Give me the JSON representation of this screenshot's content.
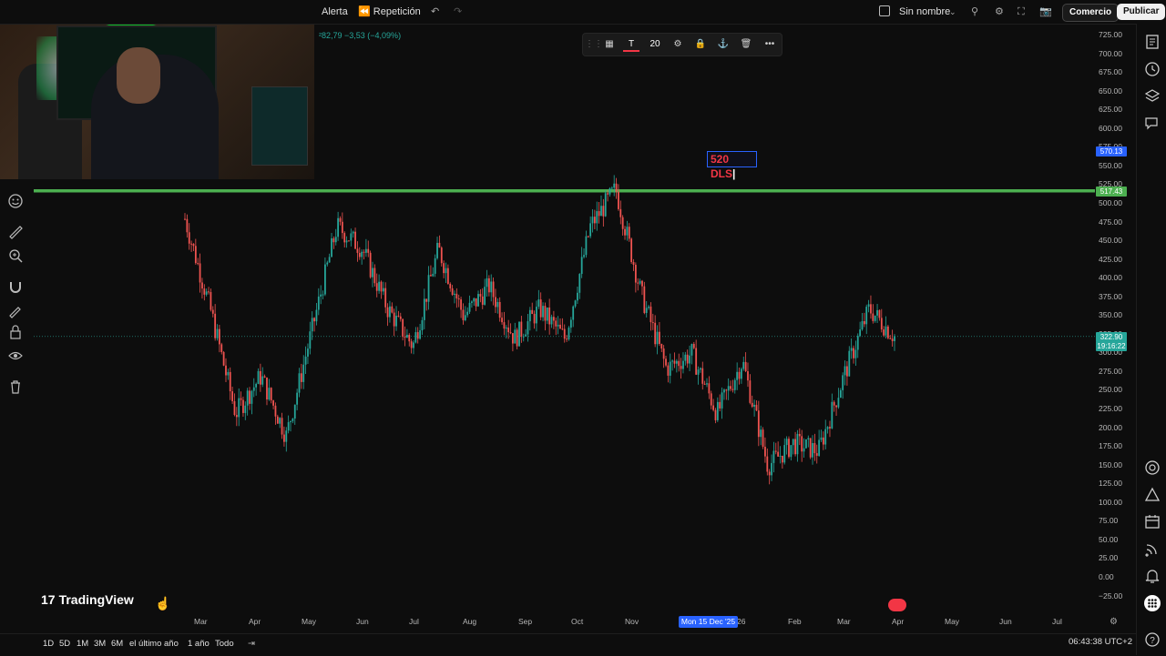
{
  "topbar": {
    "alert_label": "Alerta",
    "replay_label": "Repetición",
    "layout_name": "Sin nombre",
    "trade_label": "Comercio",
    "publish_label": "Publicar"
  },
  "legend": {
    "ohlc_text": "²82,79 −3,53 (−4,09%)"
  },
  "drawing_toolbar": {
    "font_size": "20"
  },
  "annotation": {
    "text": "520 DLS"
  },
  "price_axis": {
    "ticks": [
      "725.00",
      "700.00",
      "675.00",
      "650.00",
      "625.00",
      "600.00",
      "575.00",
      "550.00",
      "525.00",
      "500.00",
      "475.00",
      "450.00",
      "425.00",
      "400.00",
      "375.00",
      "350.00",
      "325.00",
      "300.00",
      "275.00",
      "250.00",
      "225.00",
      "200.00",
      "175.00",
      "150.00",
      "125.00",
      "100.00",
      "75.00",
      "50.00",
      "25.00",
      "0.00",
      "−25.00"
    ],
    "tag_upper": "570.13",
    "tag_line": "517.43",
    "tag_last": "322.90",
    "tag_countdown": "19:16:22"
  },
  "time_axis": {
    "labels": [
      "Mar",
      "Apr",
      "May",
      "Jun",
      "Jul",
      "Aug",
      "Sep",
      "Oct",
      "Nov",
      "26",
      "Feb",
      "Mar",
      "Apr",
      "May",
      "Jun",
      "Jul"
    ],
    "crosshair_label": "Mon 15 Dec '25"
  },
  "bottombar": {
    "ranges": [
      "1D",
      "5D",
      "1M",
      "3M",
      "6M",
      "el último año",
      "1 año",
      "Todo"
    ],
    "clock": "06:43:38 UTC+2"
  },
  "brand": {
    "logo_text": "TradingView"
  },
  "colors": {
    "up": "#26a69a",
    "down": "#ef5350",
    "level_line": "#4caf50",
    "accent": "#2962ff"
  },
  "chart_data": {
    "type": "candlestick",
    "title": "",
    "y_range": [
      -25,
      725
    ],
    "horizontal_line": 517.43,
    "last_price": 322.9,
    "path_series": [
      {
        "x": "Mar",
        "y": 480
      },
      {
        "x": "Mar",
        "y": 360
      },
      {
        "x": "Apr",
        "y": 220
      },
      {
        "x": "Apr",
        "y": 270
      },
      {
        "x": "Apr",
        "y": 190
      },
      {
        "x": "May",
        "y": 330
      },
      {
        "x": "May",
        "y": 470
      },
      {
        "x": "Jun",
        "y": 440
      },
      {
        "x": "Jun",
        "y": 360
      },
      {
        "x": "Jul",
        "y": 310
      },
      {
        "x": "Jul",
        "y": 440
      },
      {
        "x": "Aug",
        "y": 350
      },
      {
        "x": "Aug",
        "y": 390
      },
      {
        "x": "Sep",
        "y": 320
      },
      {
        "x": "Sep",
        "y": 360
      },
      {
        "x": "Oct",
        "y": 320
      },
      {
        "x": "Oct",
        "y": 470
      },
      {
        "x": "Nov",
        "y": 520
      },
      {
        "x": "Nov",
        "y": 380
      },
      {
        "x": "Dec",
        "y": 280
      },
      {
        "x": "Dec",
        "y": 300
      },
      {
        "x": "Jan",
        "y": 220
      },
      {
        "x": "Jan",
        "y": 290
      },
      {
        "x": "Feb",
        "y": 150
      },
      {
        "x": "Feb",
        "y": 180
      },
      {
        "x": "Mar",
        "y": 170
      },
      {
        "x": "Mar",
        "y": 270
      },
      {
        "x": "Apr",
        "y": 360
      },
      {
        "x": "Apr",
        "y": 322.9
      }
    ]
  }
}
